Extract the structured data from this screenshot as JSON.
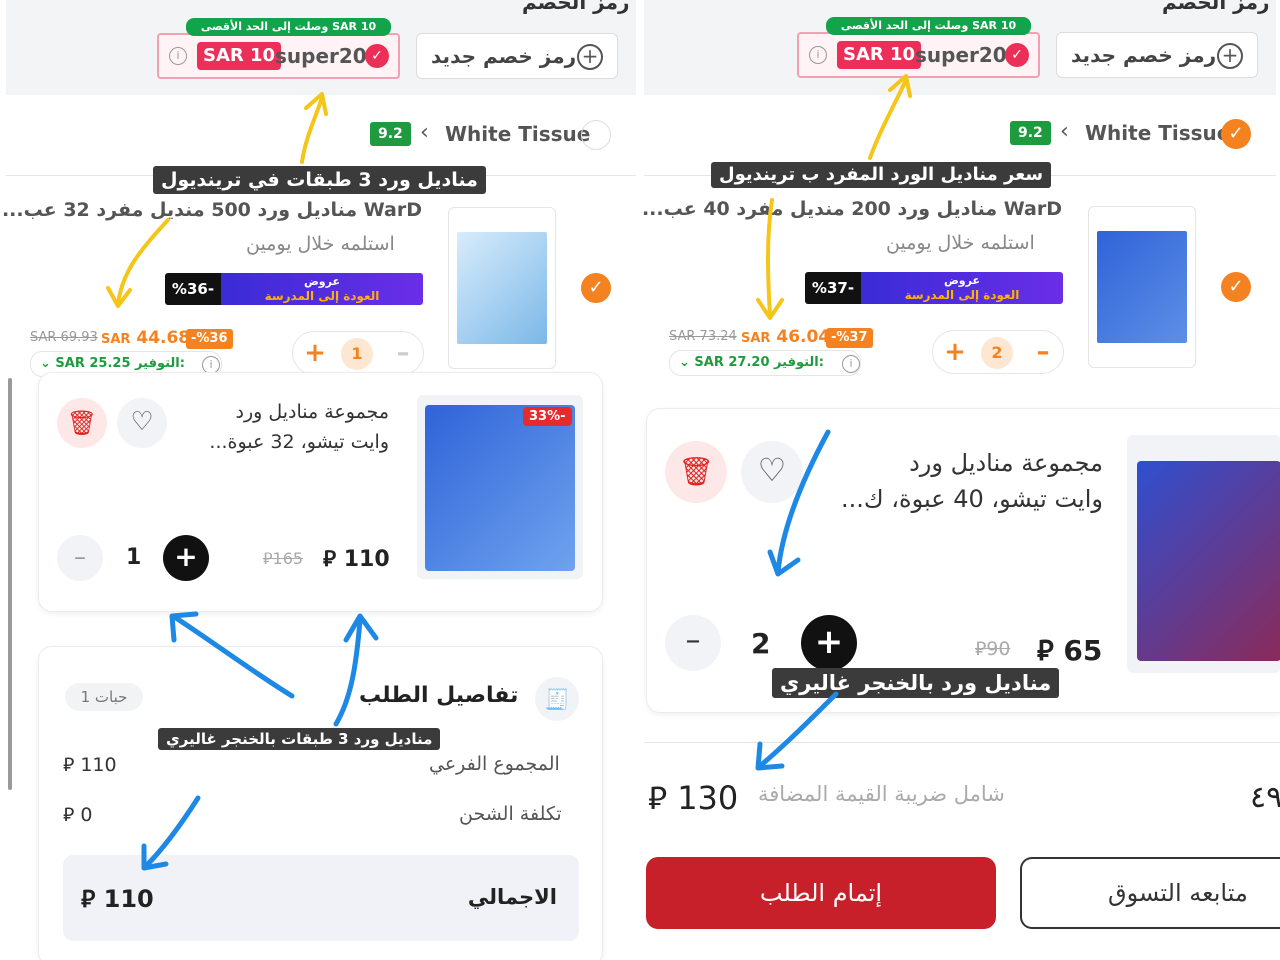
{
  "left": {
    "top_cut_text": "رمز الخصم",
    "coupon": {
      "reached_max": "وصلت إلى الحد الأقصى SAR 10",
      "amount": "SAR 10",
      "code": "super20",
      "check": "✓"
    },
    "new_code_label": "رمز خصم جديد",
    "store": {
      "rating": "9.2",
      "name": "White Tissue"
    },
    "annotation_label": "مناديل ورد 3 طبقات في ترينديول",
    "product": {
      "title": "WarD مناديل ورد 500 منديل مفرد 32 عب...",
      "delivery": "استلمه خلال يومين",
      "promo_pct": "%36-",
      "promo_top": "عروض",
      "promo_bottom": "العودة إلى المدرسة",
      "old_price": "SAR 69.93",
      "new_price_currency": "SAR",
      "new_price": "44.68",
      "discount": "-%36",
      "saving_label": "التوفير:",
      "saving_value": "SAR 25.25",
      "qty": "1"
    },
    "cart_item": {
      "title_line1": "مجموعة مناديل ورد",
      "title_line2": "وايت تيشو، 32 عبوة...",
      "badge": "33%-",
      "old_price": "165",
      "price": "110",
      "qty": "1"
    },
    "summary": {
      "title": "تفاصيل الطلب",
      "beans": "1 حبات",
      "subtotal_label": "المجموع الفرعي",
      "subtotal_value": "110",
      "shipping_label": "تكلفة الشحن",
      "shipping_value": "0",
      "total_label": "الاجمالي",
      "total_value": "110"
    },
    "annotation_label2": "مناديل ورد 3 طبقات بالخنجر غاليري"
  },
  "right": {
    "top_cut_text": "رمز الخصم",
    "coupon": {
      "reached_max": "وصلت إلى الحد الأقصى SAR 10",
      "amount": "SAR 10",
      "code": "super20",
      "check": "✓"
    },
    "new_code_label": "رمز خصم جديد",
    "store": {
      "rating": "9.2",
      "name": "White Tissue"
    },
    "annotation_label": "سعر مناديل الورد المفرد ب ترينديول",
    "product": {
      "title": "WarD مناديل ورد 200 منديل مفرد 40 عب...",
      "delivery": "استلمه خلال يومين",
      "promo_pct": "%37-",
      "promo_top": "عروض",
      "promo_bottom": "العودة إلى المدرسة",
      "old_price": "SAR 73.24",
      "new_price_currency": "SAR",
      "new_price": "46.04",
      "discount": "-%37",
      "saving_label": "التوفير:",
      "saving_value": "SAR 27.20",
      "qty": "2"
    },
    "cart_item": {
      "title_line1": "مجموعة مناديل ورد",
      "title_line2": "وايت تيشو، 40 عبوة، ك...",
      "old_price": "90",
      "price": "65",
      "qty": "2"
    },
    "annotation_label2": "مناديل ورد بالخنجر غاليري",
    "total_value": "130",
    "vat_note": "شامل ضريبة القيمة المضافة",
    "cut_total": "٤٩",
    "checkout_label": "إتمام الطلب",
    "continue_label": "متابعه التسوق"
  },
  "colors": {
    "accent_orange": "#f58220",
    "brand_red": "#c8202a",
    "coupon_pink": "#ec2f58",
    "rating_green": "#1e9b3f",
    "arrow_yellow": "#f5c518",
    "arrow_blue": "#1e88e5"
  },
  "icons": [
    "info-icon",
    "check-icon",
    "plus-circle-icon",
    "chevron-left-icon",
    "trash-icon",
    "heart-icon",
    "plus-icon",
    "minus-icon",
    "receipt-icon",
    "riyal-icon"
  ]
}
